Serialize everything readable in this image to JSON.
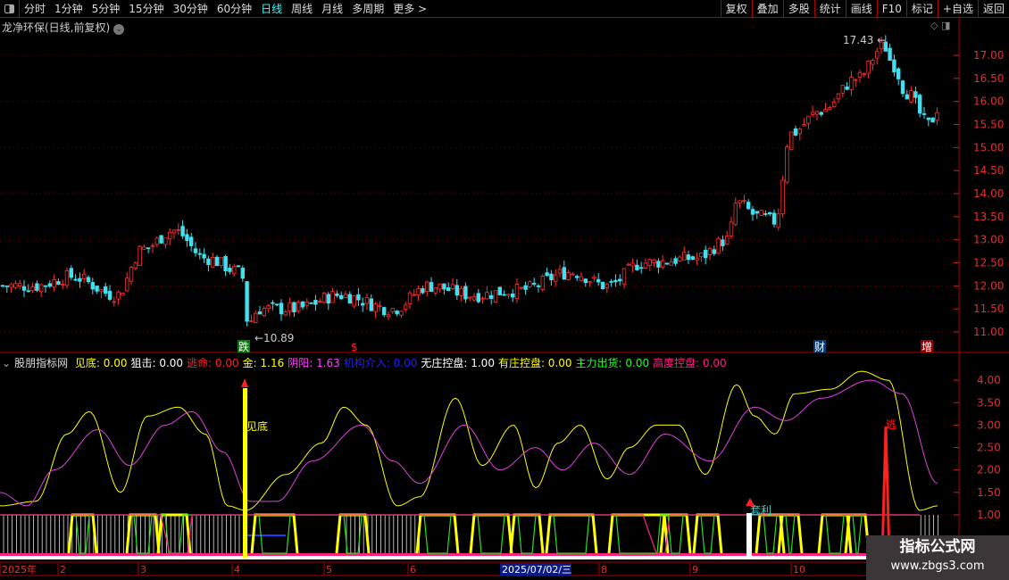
{
  "toolbar": {
    "periods": [
      "分时",
      "1分钟",
      "5分钟",
      "15分钟",
      "30分钟",
      "60分钟",
      "日线",
      "周线",
      "月线",
      "多周期",
      "更多 >"
    ],
    "active": "日线",
    "buttons": [
      "复权",
      "叠加",
      "多股",
      "统计",
      "画线",
      "F10",
      "标记",
      "+自选",
      "返回"
    ]
  },
  "stock_title": "龙净环保(日线,前复权)",
  "price_axis": [
    "17.00",
    "16.50",
    "16.00",
    "15.50",
    "15.00",
    "14.50",
    "14.00",
    "13.50",
    "13.00",
    "12.50",
    "12.00",
    "11.50",
    "11.00"
  ],
  "price_annotations": {
    "high": "17.43",
    "low": "10.89"
  },
  "markers": [
    {
      "text": "跌",
      "color": "#0a7a0a"
    },
    {
      "text": "$",
      "color": "#ff2020"
    },
    {
      "text": "财",
      "color": "#0a3a7a"
    },
    {
      "text": "增",
      "color": "#9a0000"
    }
  ],
  "price_waypoints": [
    [
      0,
      12.0
    ],
    [
      40,
      12.0
    ],
    [
      80,
      12.2
    ],
    [
      130,
      11.8
    ],
    [
      160,
      12.8
    ],
    [
      195,
      13.2
    ],
    [
      230,
      12.6
    ],
    [
      270,
      12.3
    ],
    [
      278,
      11.2
    ],
    [
      290,
      11.5
    ],
    [
      330,
      11.5
    ],
    [
      380,
      11.8
    ],
    [
      440,
      11.5
    ],
    [
      480,
      12.0
    ],
    [
      530,
      11.8
    ],
    [
      580,
      11.9
    ],
    [
      640,
      12.3
    ],
    [
      680,
      12.0
    ],
    [
      720,
      12.5
    ],
    [
      780,
      12.6
    ],
    [
      815,
      13.0
    ],
    [
      825,
      13.8
    ],
    [
      850,
      13.5
    ],
    [
      868,
      13.4
    ],
    [
      885,
      15.3
    ],
    [
      920,
      15.8
    ],
    [
      960,
      16.5
    ],
    [
      990,
      17.2
    ],
    [
      1000,
      16.8
    ],
    [
      1015,
      16.2
    ],
    [
      1040,
      15.5
    ],
    [
      1052,
      15.9
    ]
  ],
  "indicator": {
    "name": "股朋指标网",
    "items": [
      {
        "label": "见底:",
        "value": "0.00",
        "color": "#ffff00"
      },
      {
        "label": "狙击:",
        "value": "0.00",
        "color": "#ffffff"
      },
      {
        "label": "逃命:",
        "value": "0.00",
        "color": "#ff2020"
      },
      {
        "label": "金:",
        "value": "1.16",
        "color": "#ffff00"
      },
      {
        "label": "阴阳:",
        "value": "1.63",
        "color": "#ff40ff"
      },
      {
        "label": "机构介入:",
        "value": "0.00",
        "color": "#2020ff"
      },
      {
        "label": "无庄控盘:",
        "value": "1.00",
        "color": "#ffffff"
      },
      {
        "label": "有庄控盘:",
        "value": "0.00",
        "color": "#ffff00"
      },
      {
        "label": "主力出货:",
        "value": "0.00",
        "color": "#20ff20"
      },
      {
        "label": "高度控盘:",
        "value": "0.00",
        "color": "#ff2080"
      }
    ],
    "axis": [
      "4.00",
      "3.50",
      "3.00",
      "2.50",
      "2.00",
      "1.50",
      "1.00"
    ],
    "signals": [
      "见底",
      "套利",
      "逃"
    ],
    "yellow": [
      [
        0,
        1.2
      ],
      [
        40,
        1.3
      ],
      [
        75,
        2.8
      ],
      [
        100,
        3.3
      ],
      [
        135,
        1.5
      ],
      [
        165,
        3.2
      ],
      [
        200,
        3.4
      ],
      [
        230,
        2.8
      ],
      [
        255,
        1.2
      ],
      [
        275,
        1.1
      ],
      [
        320,
        1.9
      ],
      [
        360,
        2.6
      ],
      [
        385,
        3.4
      ],
      [
        410,
        3.0
      ],
      [
        445,
        1.2
      ],
      [
        470,
        1.4
      ],
      [
        510,
        3.6
      ],
      [
        540,
        2.1
      ],
      [
        575,
        3.0
      ],
      [
        600,
        1.6
      ],
      [
        625,
        2.6
      ],
      [
        650,
        3.0
      ],
      [
        680,
        1.8
      ],
      [
        705,
        2.5
      ],
      [
        735,
        3.0
      ],
      [
        760,
        3.0
      ],
      [
        790,
        1.9
      ],
      [
        825,
        3.9
      ],
      [
        845,
        3.2
      ],
      [
        868,
        2.8
      ],
      [
        890,
        3.7
      ],
      [
        930,
        3.8
      ],
      [
        965,
        4.2
      ],
      [
        995,
        4.0
      ],
      [
        1030,
        1.1
      ],
      [
        1050,
        1.2
      ]
    ],
    "magenta": [
      [
        0,
        1.5
      ],
      [
        30,
        1.2
      ],
      [
        60,
        2.0
      ],
      [
        110,
        2.9
      ],
      [
        145,
        2.1
      ],
      [
        185,
        3.0
      ],
      [
        215,
        3.3
      ],
      [
        250,
        2.4
      ],
      [
        280,
        1.3
      ],
      [
        310,
        1.3
      ],
      [
        350,
        2.2
      ],
      [
        405,
        3.0
      ],
      [
        440,
        2.2
      ],
      [
        470,
        1.7
      ],
      [
        520,
        3.0
      ],
      [
        560,
        2.0
      ],
      [
        600,
        2.5
      ],
      [
        630,
        2.0
      ],
      [
        665,
        2.6
      ],
      [
        705,
        1.9
      ],
      [
        745,
        2.8
      ],
      [
        795,
        2.2
      ],
      [
        845,
        3.4
      ],
      [
        880,
        3.1
      ],
      [
        920,
        3.6
      ],
      [
        975,
        4.0
      ],
      [
        1010,
        3.7
      ],
      [
        1050,
        1.7
      ]
    ]
  },
  "time_axis": [
    "2025年",
    "2",
    "3",
    "4",
    "5",
    "6",
    "7",
    "2025/07/02/三",
    "8",
    "9",
    "10"
  ],
  "watermark": {
    "line1": "指标公式网",
    "line2": "www.zbgs3.com"
  }
}
